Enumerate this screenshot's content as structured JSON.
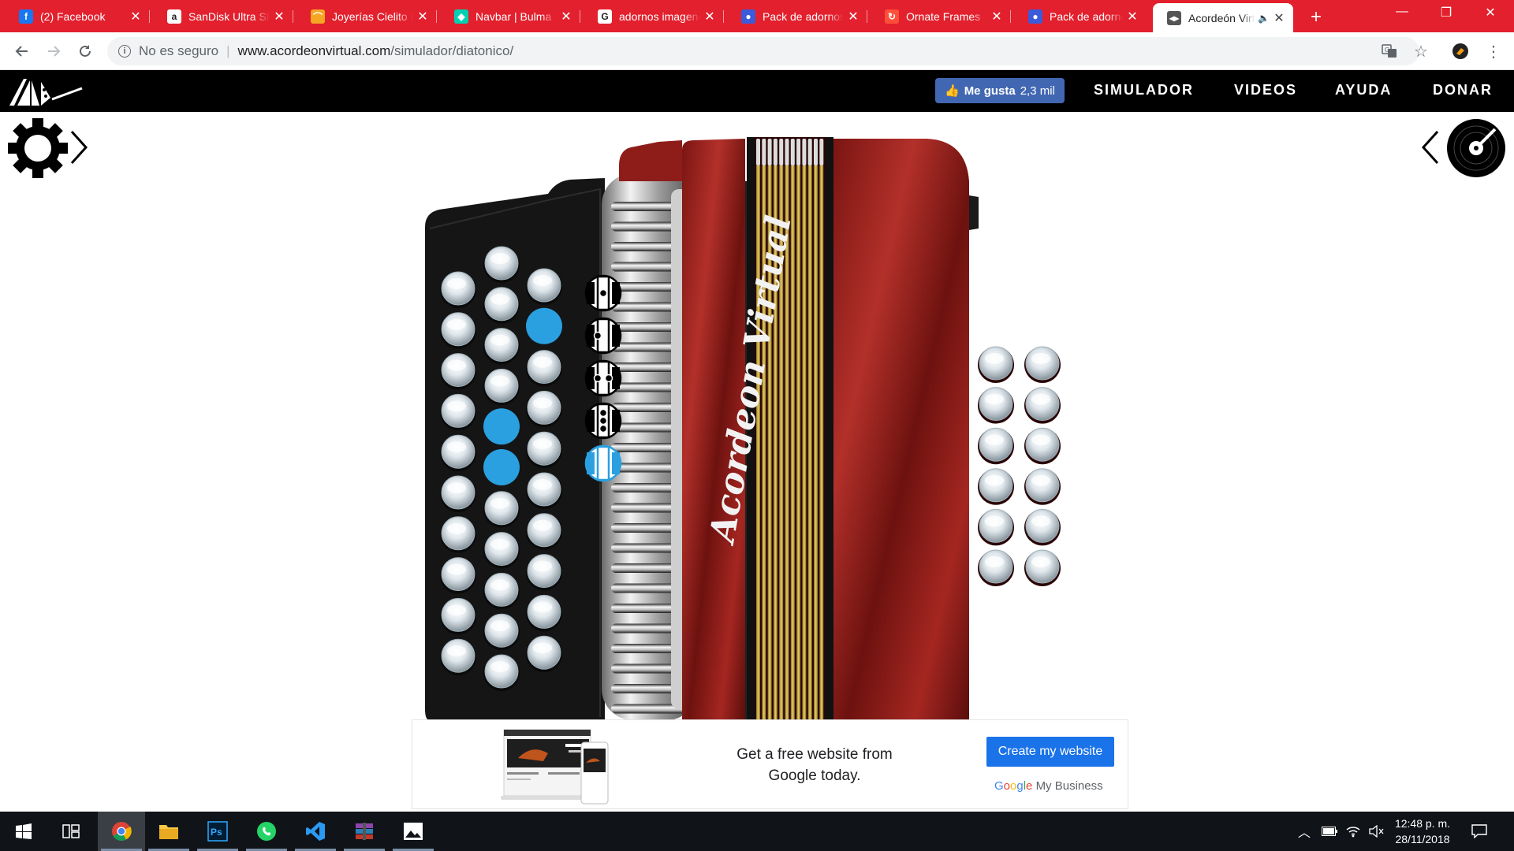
{
  "browser": {
    "tabs": [
      {
        "title": "(2) Facebook",
        "icon": "facebook-icon",
        "color": "#1877f2",
        "glyph": "f"
      },
      {
        "title": "SanDisk Ultra SDHC",
        "icon": "amazon-icon",
        "color": "#ffffff",
        "glyph": "a"
      },
      {
        "title": "Joyerías Cielito Lindo",
        "icon": "jewelry-icon",
        "color": "#f5a623",
        "glyph": "⌒"
      },
      {
        "title": "Navbar | Bulma",
        "icon": "bulma-icon",
        "color": "#00d1b2",
        "glyph": "◆"
      },
      {
        "title": "adornos imagenes",
        "icon": "google-icon",
        "color": "#ffffff",
        "glyph": "G"
      },
      {
        "title": "Pack de adornos",
        "icon": "globe-icon",
        "color": "#3b5bdb",
        "glyph": "●"
      },
      {
        "title": "Ornate Frames",
        "icon": "frames-icon",
        "color": "#ff4f3a",
        "glyph": "↻"
      },
      {
        "title": "Pack de adornos",
        "icon": "globe-icon",
        "color": "#3b5bdb",
        "glyph": "●"
      },
      {
        "title": "Acordeón Virtual",
        "icon": "acordeon-icon",
        "color": "#555555",
        "glyph": "◂▸",
        "active": true
      }
    ],
    "url": {
      "security": "No es seguro",
      "host": "www.acordeonvirtual.com",
      "path": "/simulador/diatonico/"
    }
  },
  "site": {
    "like_label": "Me gusta",
    "like_count": "2,3 mil",
    "nav": [
      "SIMULADOR",
      "VIDEOS",
      "AYUDA",
      "DONAR"
    ]
  },
  "accordion": {
    "brand_text": "Acordeon Virtual",
    "colors": {
      "body": "#8e1d1a",
      "bellows": "#c9c9c9",
      "reeds": "#c8a83c",
      "highlight": "#2aa0e0"
    },
    "treble_rows": [
      {
        "row": 1,
        "buttons": 10,
        "pressed_indices": []
      },
      {
        "row": 2,
        "buttons": 11,
        "pressed_indices": [
          4,
          5
        ]
      },
      {
        "row": 3,
        "buttons": 10,
        "pressed_indices": [
          1
        ]
      }
    ],
    "register_switches": [
      {
        "name": "register-1",
        "selected": false
      },
      {
        "name": "register-2",
        "selected": false
      },
      {
        "name": "register-3",
        "selected": false
      },
      {
        "name": "register-4",
        "selected": false
      },
      {
        "name": "register-5",
        "selected": true
      }
    ],
    "bass_rows": [
      {
        "row": 1,
        "buttons": 6
      },
      {
        "row": 2,
        "buttons": 6
      }
    ]
  },
  "ad": {
    "text_line1": "Get a free website from",
    "text_line2": "Google today.",
    "button": "Create my website",
    "brand_google": "Google",
    "brand_rest": "My Business"
  },
  "taskbar": {
    "apps": [
      "windows-start-icon",
      "task-view-icon",
      "chrome-icon",
      "file-explorer-icon",
      "photoshop-icon",
      "whatsapp-icon",
      "vscode-icon",
      "winrar-icon",
      "photos-icon"
    ],
    "time": "12:48 p. m.",
    "date": "28/11/2018"
  }
}
